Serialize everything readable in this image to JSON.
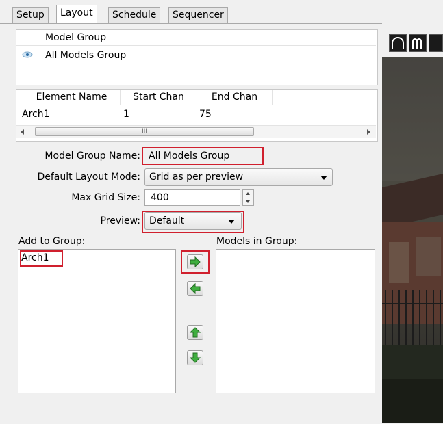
{
  "tabs": [
    "Setup",
    "Layout",
    "Schedule",
    "Sequencer"
  ],
  "groups_table": {
    "header": "Model Group",
    "rows": [
      {
        "name": "All Models Group",
        "icon": "eye-icon"
      }
    ]
  },
  "elements_table": {
    "headers": [
      "Element Name",
      "Start Chan",
      "End Chan"
    ],
    "rows": [
      [
        "Arch1",
        "1",
        "75"
      ]
    ],
    "scroll_grip": "III"
  },
  "form": {
    "group_name_label": "Model Group Name:",
    "group_name_value": "All Models Group",
    "layout_mode_label": "Default Layout Mode:",
    "layout_mode_value": "Grid as per preview",
    "grid_size_label": "Max Grid Size:",
    "grid_size_value": "400",
    "preview_label": "Preview:",
    "preview_value": "Default"
  },
  "add_to_group": {
    "label": "Add to Group:",
    "items": [
      "Arch1"
    ]
  },
  "models_in_group": {
    "label": "Models in Group:",
    "items": []
  },
  "colors": {
    "highlight": "#d0202e",
    "arrow_green": "#3fae3f"
  }
}
